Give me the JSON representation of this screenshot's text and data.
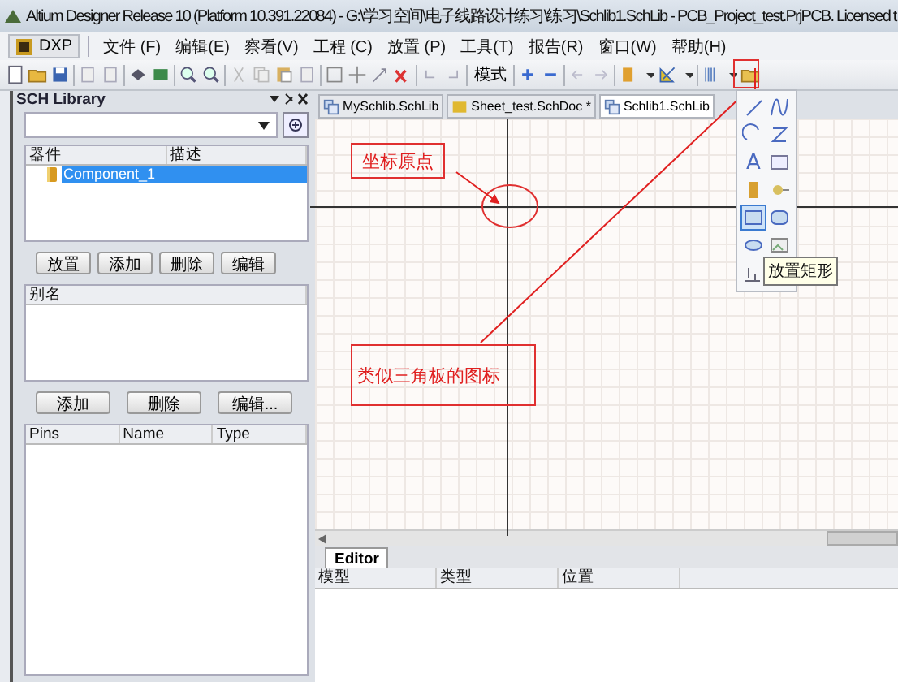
{
  "window": {
    "title": "Altium Designer Release 10 (Platform 10.391.22084) - G:\\学习空间\\电子线路设计练习\\练习\\Schlib1.SchLib - PCB_Project_test.PrjPCB. Licensed t"
  },
  "menu": [
    {
      "label": "DXP",
      "kind": "logo"
    },
    {
      "label": "文件 (F)",
      "kind": "item"
    },
    {
      "label": "编辑(E)",
      "kind": "item"
    },
    {
      "label": "察看(V)",
      "kind": "item"
    },
    {
      "label": "工程 (C)",
      "kind": "item"
    },
    {
      "label": "放置 (P)",
      "kind": "item"
    },
    {
      "label": "工具(T)",
      "kind": "item"
    },
    {
      "label": "报告(R)",
      "kind": "item"
    },
    {
      "label": "窗口(W)",
      "kind": "item"
    },
    {
      "label": "帮助(H)",
      "kind": "item"
    }
  ],
  "toolbar": {
    "mode_button": "模式"
  },
  "sch_library": {
    "title": "SCH Library",
    "components": {
      "columns": [
        "器件",
        "描述"
      ],
      "rows": [
        {
          "name": "Component_1",
          "selected": true
        }
      ]
    },
    "component_buttons": [
      "放置",
      "添加",
      "删除",
      "编辑"
    ],
    "aliases": {
      "columns": [
        "别名"
      ]
    },
    "alias_buttons": [
      "添加",
      "删除",
      "编辑..."
    ],
    "pins": {
      "columns": [
        "Pins",
        "Name",
        "Type"
      ]
    }
  },
  "document_tabs": [
    {
      "label": "MySchlib.SchLib",
      "selected": false
    },
    {
      "label": "Sheet_test.SchDoc *",
      "selected": false
    },
    {
      "label": "Schlib1.SchLib",
      "selected": true
    }
  ],
  "annotations": [
    {
      "text": "坐标原点"
    },
    {
      "text": "类似三角板的图标"
    }
  ],
  "drawing_palette": {
    "tools": [
      {
        "kind": "line",
        "selected": false
      },
      {
        "kind": "bezier",
        "selected": false
      },
      {
        "kind": "arc",
        "selected": false
      },
      {
        "kind": "polygon",
        "selected": false
      },
      {
        "kind": "text",
        "glyph": "A",
        "selected": false
      },
      {
        "kind": "frame",
        "selected": false
      },
      {
        "kind": "component",
        "selected": false
      },
      {
        "kind": "pin",
        "selected": false
      },
      {
        "kind": "rectangle",
        "selected": true
      },
      {
        "kind": "roundrect",
        "selected": false
      },
      {
        "kind": "ellipse",
        "selected": false
      },
      {
        "kind": "image",
        "selected": false
      },
      {
        "kind": "array",
        "selected": false
      }
    ],
    "tooltip": "放置矩形"
  },
  "editor_panel": {
    "tabs": [
      {
        "label": "Editor",
        "selected": true
      }
    ],
    "columns": [
      "模型",
      "类型",
      "位置"
    ]
  }
}
